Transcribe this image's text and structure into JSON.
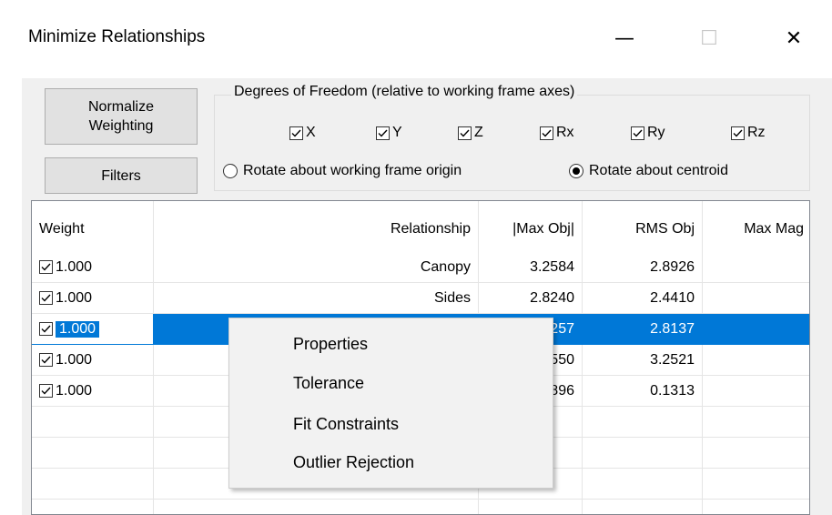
{
  "window": {
    "title": "Minimize Relationships",
    "minimize_glyph": "—",
    "maximize_glyph": "☐",
    "close_glyph": "✕"
  },
  "buttons": {
    "normalize_line1": "Normalize",
    "normalize_line2": "Weighting",
    "filters": "Filters"
  },
  "dof": {
    "label": "Degrees of Freedom (relative to working frame axes)",
    "axes": [
      {
        "label": "X",
        "checked": true
      },
      {
        "label": "Y",
        "checked": true
      },
      {
        "label": "Z",
        "checked": true
      },
      {
        "label": "Rx",
        "checked": true
      },
      {
        "label": "Ry",
        "checked": true
      },
      {
        "label": "Rz",
        "checked": true
      }
    ],
    "rotate_origin": "Rotate about working frame origin",
    "rotate_centroid": "Rotate about centroid",
    "selected_rotation": "centroid"
  },
  "table": {
    "columns": [
      "Weight",
      "Relationship",
      "|Max Obj|",
      "RMS Obj",
      "Max Mag"
    ],
    "rows": [
      {
        "checked": true,
        "weight": "1.000",
        "relationship": "Canopy",
        "max_obj": "3.2584",
        "rms_obj": "2.8926",
        "max_mag": ""
      },
      {
        "checked": true,
        "weight": "1.000",
        "relationship": "Sides",
        "max_obj": "2.8240",
        "rms_obj": "2.4410",
        "max_mag": ""
      },
      {
        "checked": true,
        "weight": "1.000",
        "relationship": "",
        "max_obj": "257",
        "rms_obj": "2.8137",
        "max_mag": "",
        "selected": true
      },
      {
        "checked": true,
        "weight": "1.000",
        "relationship": "",
        "max_obj": "550",
        "rms_obj": "3.2521",
        "max_mag": ""
      },
      {
        "checked": true,
        "weight": "1.000",
        "relationship": "",
        "max_obj": "896",
        "rms_obj": "0.1313",
        "max_mag": ""
      }
    ]
  },
  "context_menu": {
    "items": [
      "Properties",
      "Tolerance",
      "Fit Constraints",
      "Outlier Rejection"
    ]
  },
  "colors": {
    "selection": "#0078d7",
    "dialog_bg": "#f0f0f0"
  }
}
